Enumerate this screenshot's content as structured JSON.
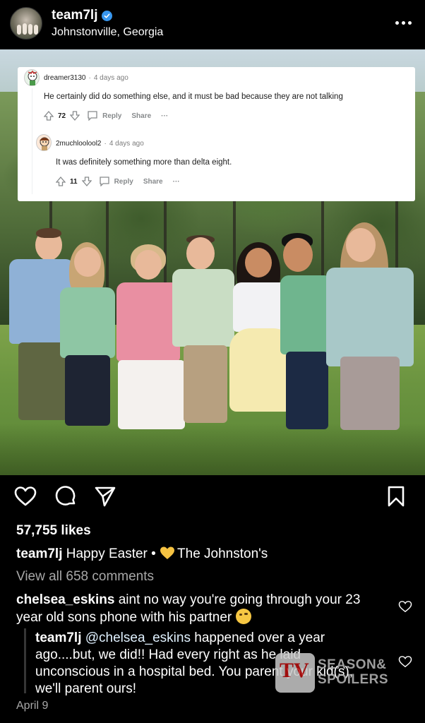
{
  "header": {
    "username": "team7lj",
    "location": "Johnstonville, Georgia",
    "avatar_icon": "profile-avatar",
    "verified_icon": "verified-badge-icon",
    "more_icon": "more-options-icon"
  },
  "reddit_overlay": {
    "comments": [
      {
        "user": "dreamer3130",
        "time": "4 days ago",
        "body": "He certainly did do something else, and it must be bad because they are not talking",
        "score": "72",
        "reply_label": "Reply",
        "share_label": "Share",
        "more_label": "···"
      },
      {
        "user": "2muchloolool2",
        "time": "4 days ago",
        "body": "It was definitely something more than delta eight.",
        "score": "11",
        "reply_label": "Reply",
        "share_label": "Share",
        "more_label": "···"
      }
    ]
  },
  "actions": {
    "like_icon": "heart-icon",
    "comment_icon": "comment-icon",
    "share_icon": "send-icon",
    "save_icon": "bookmark-icon"
  },
  "post": {
    "likes": "57,755 likes",
    "caption_user": "team7lj",
    "caption_text": "Happy Easter •",
    "caption_suffix": "The Johnston's",
    "view_all": "View all 658 comments",
    "date": "April 9"
  },
  "comments": [
    {
      "user": "chelsea_eskins",
      "text": "aint no way you're going through your 23 year old sons phone with his partner"
    }
  ],
  "reply": {
    "user": "team7lj",
    "mention": "@chelsea_eskins",
    "text": "happened over a year ago....but, we did!! Had every right as he laid unconscious in a hospital bed. You parent your kid(s), we'll parent ours!"
  },
  "watermark": {
    "logo": "TV",
    "line1": "SEASON&",
    "line2": "SPOILERS"
  },
  "colors": {
    "background": "#000000",
    "verified": "#3897f0",
    "muted_text": "#a8a8a8",
    "emoji_heart": "#f5c242"
  }
}
